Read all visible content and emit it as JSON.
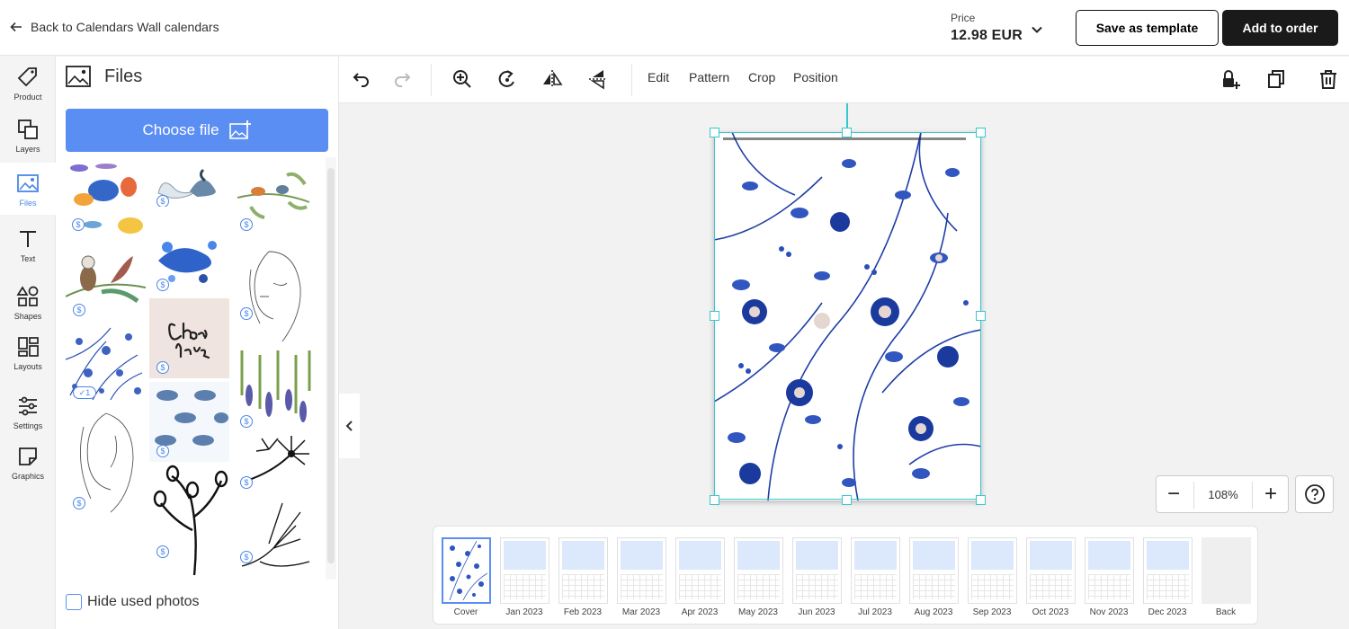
{
  "header": {
    "back_label": "Back to Calendars Wall calendars",
    "price_label": "Price",
    "price_value": "12.98 EUR",
    "save_template_label": "Save as template",
    "add_to_order_label": "Add to order"
  },
  "rail": {
    "items": [
      {
        "label": "Product",
        "icon": "tag-icon"
      },
      {
        "label": "Layers",
        "icon": "layers-icon"
      },
      {
        "label": "Files",
        "icon": "image-icon",
        "active": true
      },
      {
        "label": "Text",
        "icon": "text-icon"
      },
      {
        "label": "Shapes",
        "icon": "shapes-icon"
      },
      {
        "label": "Layouts",
        "icon": "layouts-icon"
      },
      {
        "label": "Settings",
        "icon": "sliders-icon"
      },
      {
        "label": "Graphics",
        "icon": "sticker-icon"
      }
    ]
  },
  "files": {
    "title": "Files",
    "choose_label": "Choose file",
    "hide_used_label": "Hide used photos",
    "badge": "$",
    "used_badge": "✓1"
  },
  "toolbar": {
    "edit_label": "Edit",
    "pattern_label": "Pattern",
    "crop_label": "Crop",
    "position_label": "Position"
  },
  "zoom": {
    "value": "108%",
    "minus": "−",
    "plus": "+"
  },
  "months": {
    "labels": [
      "Cover",
      "Jan 2023",
      "Feb 2023",
      "Mar 2023",
      "Apr 2023",
      "May 2023",
      "Jun 2023",
      "Jul 2023",
      "Aug 2023",
      "Sep 2023",
      "Oct 2023",
      "Nov 2023",
      "Dec 2023",
      "Back"
    ]
  },
  "colors": {
    "accent": "#5b8ef2",
    "selection": "#36c7cf",
    "pattern_blue": "#2b4fb8"
  }
}
